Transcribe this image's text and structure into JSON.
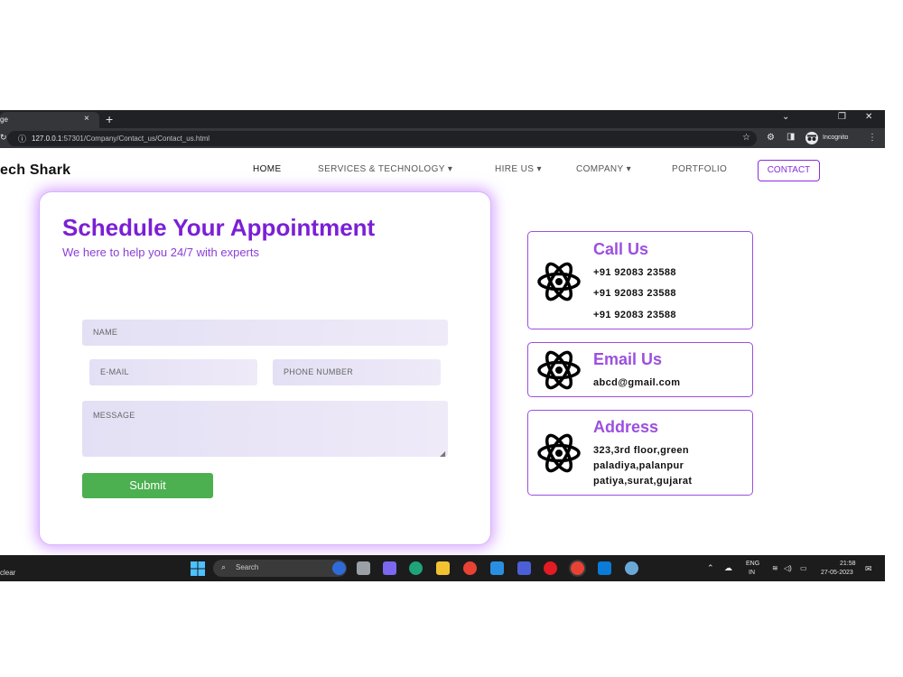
{
  "browser": {
    "tab_title": "ge",
    "tab_close": "×",
    "new_tab": "+",
    "window_controls": [
      "⌄",
      "❐",
      "✕"
    ],
    "url_host": "127.0.0.1",
    "url_path": ":57301/Company/Contact_us/Contact_us.html",
    "profile_label": "Incognito"
  },
  "nav": {
    "brand": "ech Shark",
    "items": [
      {
        "label": "HOME"
      },
      {
        "label": "SERVICES & TECHNOLOGY ▾"
      },
      {
        "label": "HIRE US ▾"
      },
      {
        "label": "COMPANY ▾"
      },
      {
        "label": "PORTFOLIO"
      }
    ],
    "contact_button": "CONTACT"
  },
  "form": {
    "title": "Schedule Your Appointment",
    "subtitle": "We here to help you 24/7 with experts",
    "name_placeholder": "NAME",
    "email_placeholder": "E-MAIL",
    "phone_placeholder": "PHONE NUMBER",
    "message_placeholder": "MESSAGE",
    "submit_label": "Submit"
  },
  "cards": {
    "call": {
      "title": "Call Us",
      "lines": [
        "+91 92083 23588",
        "+91 92083 23588",
        "+91 92083 23588"
      ]
    },
    "email": {
      "title": "Email Us",
      "lines": [
        "abcd@gmail.com"
      ]
    },
    "address": {
      "title": "Address",
      "lines": [
        "323,3rd floor,green",
        "paladiya,palanpur",
        "patiya,surat,gujarat"
      ]
    }
  },
  "taskbar": {
    "weather": "clear",
    "search_label": "Search",
    "lang_top": "ENG",
    "lang_bottom": "IN",
    "time": "21:58",
    "date": "27-05-2023"
  },
  "colors": {
    "accent": "#7b1fd6",
    "card_border": "#9c4fe0",
    "submit": "#4caf50"
  }
}
